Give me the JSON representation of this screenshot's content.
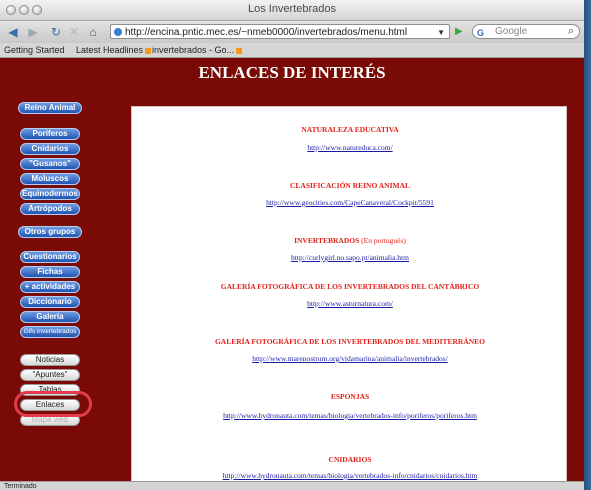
{
  "window": {
    "title": "Los Invertebrados"
  },
  "toolbar": {
    "back_icon": "back-arrow-icon",
    "forward_icon": "forward-arrow-icon",
    "reload_icon": "reload-icon",
    "stop_icon": "stop-icon",
    "home_icon": "home-icon",
    "url": "http://encina.pntic.mec.es/~nmeb0000/invertebrados/menu.html",
    "search_engine": "G",
    "search_placeholder": "Google"
  },
  "bookmarks": [
    {
      "label": "Getting Started"
    },
    {
      "label": "Latest Headlines"
    },
    {
      "label": "invertebrados - Go..."
    }
  ],
  "page": {
    "heading": "ENLACES DE INTERÉS"
  },
  "sidebar": {
    "main": "Reino Animal",
    "groups": [
      "Poríferos",
      "Cnidarios",
      "\"Gusanos\"",
      "Moluscos",
      "Equinodermos",
      "Artrópodos"
    ],
    "others": "Otros grupos",
    "tools": [
      "Cuestionarios",
      "Fichas",
      "+ actividades",
      "Diccionario",
      "Galería",
      "Gifs invertebrados"
    ],
    "secondary": [
      "Noticias",
      "\"Apuntes\"",
      "Tablas",
      "Enlaces",
      "Mapa web"
    ]
  },
  "links": [
    {
      "title": "NATURALEZA EDUCATIVA",
      "note": "",
      "url": "http://www.natureduca.com/"
    },
    {
      "title": "CLASIFICACIÓN REINO ANIMAL",
      "note": "",
      "url": "http://www.geocities.com/CapeCanaveral/Cockpit/5591"
    },
    {
      "title": "INVERTEBRADOS",
      "note": "(En portugués)",
      "url": "http://curlygirl.no.sapo.pt/animalia.htm"
    },
    {
      "title": "GALERÍA FOTOGRÁFICA DE LOS INVERTEBRADOS DEL CANTÁBRICO",
      "note": "",
      "url": "http://www.asturnatura.com/"
    },
    {
      "title": "GALERÍA FOTOGRÁFICA DE LOS INVERTEBRADOS DEL MEDITERRÁNEO",
      "note": "",
      "url": "http://www.marenostrum.org/vidamarina/animalia/invertebrados/"
    },
    {
      "title": "ESPONJAS",
      "note": "",
      "url": "http://www.hydronauta.com/temas/biologia/vertebrados-info/poriferos/poriferos.htm"
    },
    {
      "title": "CNIDARIOS",
      "note": "",
      "url": "http://www.hydronauta.com/temas/biologia/vertebrados-info/cnidarios/cnidarios.htm"
    }
  ],
  "status": {
    "text": "Terminado"
  },
  "colors": {
    "page_bg": "#7a0a05",
    "link_title": "#e0221c",
    "link_url": "#1a1aa6",
    "highlight": "#e23b4e"
  }
}
